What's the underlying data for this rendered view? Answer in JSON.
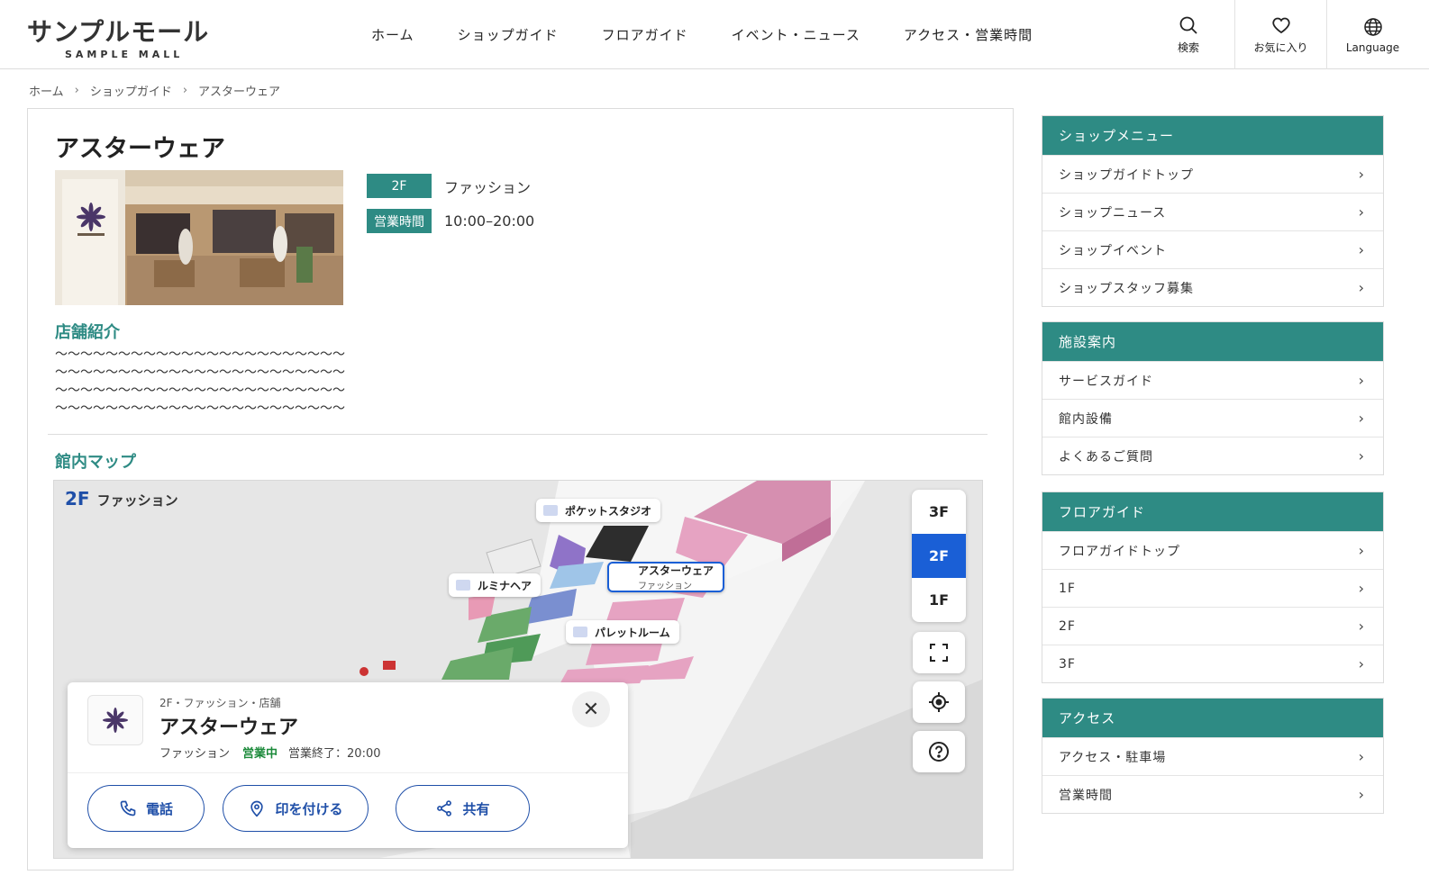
{
  "header": {
    "logo_jp": "サンプルモール",
    "logo_en": "SAMPLE MALL",
    "nav": [
      "ホーム",
      "ショップガイド",
      "フロアガイド",
      "イベント・ニュース",
      "アクセス・営業時間"
    ],
    "icons": [
      {
        "label": "検索",
        "icon": "search-icon"
      },
      {
        "label": "お気に入り",
        "icon": "heart-icon"
      },
      {
        "label": "Language",
        "icon": "globe-icon"
      }
    ]
  },
  "breadcrumb": [
    "ホーム",
    "ショップガイド",
    "アスターウェア"
  ],
  "shop": {
    "name": "アスターウェア",
    "floor": "2F",
    "category": "ファッション",
    "hours_label": "営業時間",
    "hours": "10:00–20:00",
    "intro_title": "店舗紹介",
    "intro_lines": [
      "〜〜〜〜〜〜〜〜〜〜〜〜〜〜〜〜〜〜〜〜〜〜〜",
      "〜〜〜〜〜〜〜〜〜〜〜〜〜〜〜〜〜〜〜〜〜〜〜",
      "〜〜〜〜〜〜〜〜〜〜〜〜〜〜〜〜〜〜〜〜〜〜〜",
      "〜〜〜〜〜〜〜〜〜〜〜〜〜〜〜〜〜〜〜〜〜〜〜"
    ]
  },
  "map": {
    "title": "館内マップ",
    "floor": "2F",
    "category": "ファッション",
    "pins": {
      "pocket": "ポケットスタジオ",
      "lumina": "ルミナヘア",
      "aster": "アスターウェア",
      "aster_sub": "ファッション",
      "palette": "パレットルーム"
    },
    "floors": [
      "3F",
      "2F",
      "1F"
    ],
    "active_floor": "2F",
    "card": {
      "meta": "2F・ファッション・店舗",
      "name": "アスターウェア",
      "category": "ファッション",
      "status": "営業中",
      "closing": "営業終了：20:00",
      "buttons": {
        "phone": "電話",
        "mark": "印を付ける",
        "share": "共有"
      }
    }
  },
  "sidebar": [
    {
      "title": "ショップメニュー",
      "items": [
        "ショップガイドトップ",
        "ショップニュース",
        "ショップイベント",
        "ショップスタッフ募集"
      ]
    },
    {
      "title": "施設案内",
      "items": [
        "サービスガイド",
        "館内設備",
        "よくあるご質問"
      ]
    },
    {
      "title": "フロアガイド",
      "items": [
        "フロアガイドトップ",
        "1F",
        "2F",
        "3F"
      ]
    },
    {
      "title": "アクセス",
      "items": [
        "アクセス・駐車場",
        "営業時間"
      ]
    }
  ],
  "colors": {
    "accent": "#2e8b84",
    "map_blue": "#1a5fd6",
    "open_green": "#1b8a3a"
  }
}
